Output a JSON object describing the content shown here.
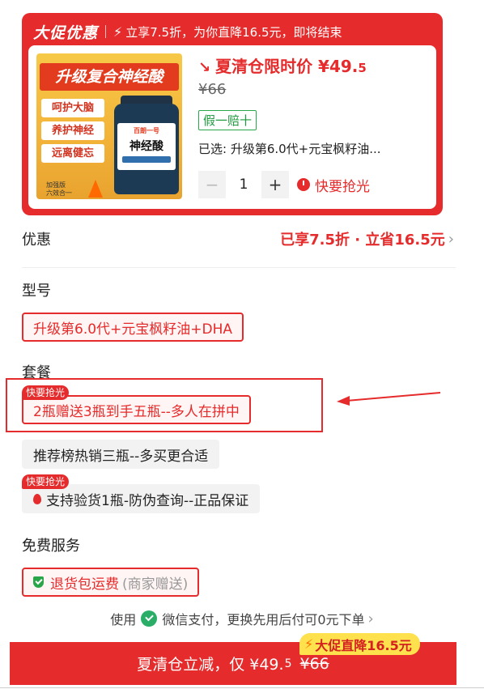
{
  "promo": {
    "logo": "大促优惠",
    "headline": "立享7.5折，为你直降16.5元，即将结束",
    "image": {
      "title": "升级复合神经酸",
      "tags": [
        "呵护大脑",
        "养护神经",
        "远离健忘"
      ],
      "small_text": "加强版\n六效合一",
      "bottle_top": "百朗一号",
      "bottle_main": "神经酸"
    },
    "limited_label": "夏清仓限时价 ¥49.",
    "limited_cents": "5",
    "old_price": "¥66",
    "guarantee": "假一赔十",
    "selected": "已选: 升级第6.0代+元宝枫籽油...",
    "qty": "1",
    "minus": "−",
    "plus": "+",
    "sellout": "快要抢光"
  },
  "discount": {
    "label": "优惠",
    "value": "已享7.5折 · 立省16.5元"
  },
  "model": {
    "title": "型号",
    "option": "升级第6.0代+元宝枫籽油+DHA"
  },
  "package": {
    "title": "套餐",
    "options": [
      {
        "label": "2瓶赠送3瓶到手五瓶--多人在拼中",
        "tag": "快要抢光"
      },
      {
        "label": "推荐榜热销三瓶--多买更合适",
        "tag": ""
      },
      {
        "label": "支持验货1瓶-防伪查询--正品保证",
        "tag": "快要抢光"
      }
    ]
  },
  "service": {
    "title": "免费服务",
    "label": "退货包运费",
    "note": "(商家赠送)"
  },
  "pay": {
    "prefix": "使用",
    "text": "微信支付，更换先用后付可0元下单"
  },
  "buy": {
    "label": "夏清仓立减，仅 ¥49.",
    "cents": "5",
    "old": "¥66",
    "badge": "大促直降16.5元"
  },
  "colors": {
    "accent": "#e52b2b",
    "green": "#2aa64a",
    "badge_yellow": "#ffe14d"
  }
}
